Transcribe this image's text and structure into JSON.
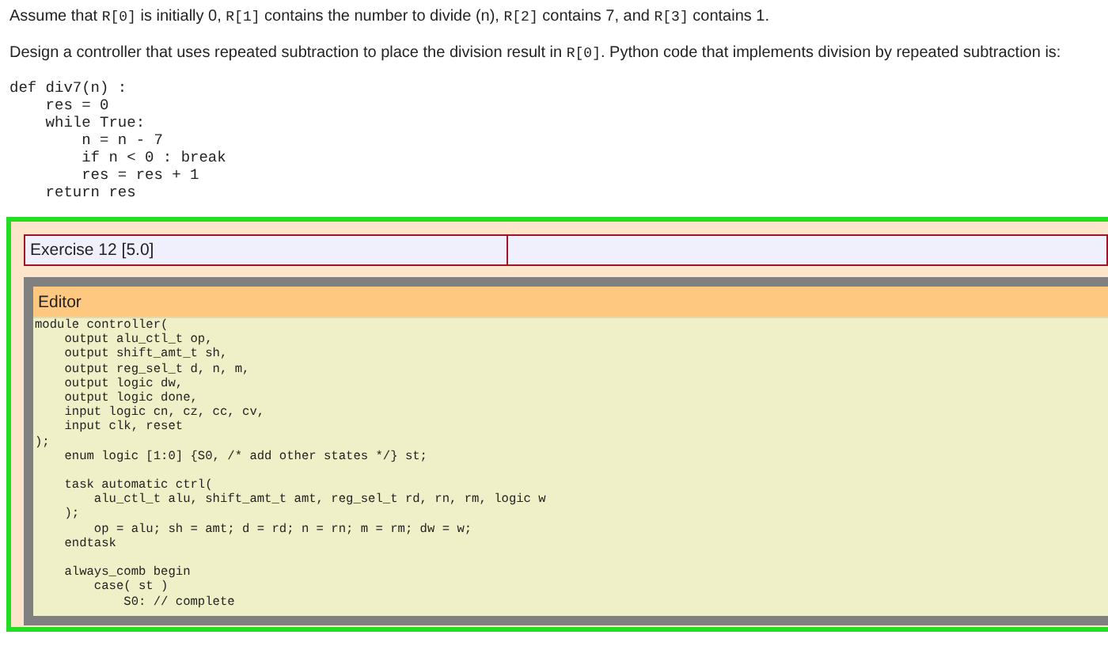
{
  "question": {
    "paragraphs": [
      [
        {
          "kind": "text",
          "text": "Assume that "
        },
        {
          "kind": "code",
          "text": "R[0]"
        },
        {
          "kind": "text",
          "text": " is initially 0, "
        },
        {
          "kind": "code",
          "text": "R[1]"
        },
        {
          "kind": "text",
          "text": " contains the number to divide (n), "
        },
        {
          "kind": "code",
          "text": "R[2]"
        },
        {
          "kind": "text",
          "text": " contains 7, and "
        },
        {
          "kind": "code",
          "text": "R[3]"
        },
        {
          "kind": "text",
          "text": " contains 1."
        }
      ],
      [
        {
          "kind": "text",
          "text": "Design a controller that uses repeated subtraction to place the division result in "
        },
        {
          "kind": "code",
          "text": "R[0]"
        },
        {
          "kind": "text",
          "text": ". Python code that implements division by repeated subtraction is:"
        }
      ]
    ],
    "code": [
      "def div7(n) :",
      "    res = 0",
      "    while True:",
      "        n = n - 7",
      "        if n < 0 : break",
      "        res = res + 1",
      "    return res"
    ]
  },
  "exercise": {
    "title": "Exercise 12 [5.0]",
    "editor": {
      "title": "Editor",
      "blocks": [
        [
          "module controller(",
          "    output alu_ctl_t op,",
          "    output shift_amt_t sh,",
          "    output reg_sel_t d, n, m,",
          "    output logic dw,",
          "    output logic done,",
          "    input logic cn, cz, cc, cv,",
          "    input clk, reset",
          ");",
          "    enum logic [1:0] {S0, /* add other states */} st;"
        ],
        [
          "    task automatic ctrl(",
          "        alu_ctl_t alu, shift_amt_t amt, reg_sel_t rd, rn, rm, logic w",
          "    );",
          "        op = alu; sh = amt; d = rd; n = rn; m = rm; dw = w;",
          "    endtask"
        ],
        [
          "    always_comb begin",
          "        case( st )",
          "            S0: // complete"
        ]
      ]
    }
  }
}
